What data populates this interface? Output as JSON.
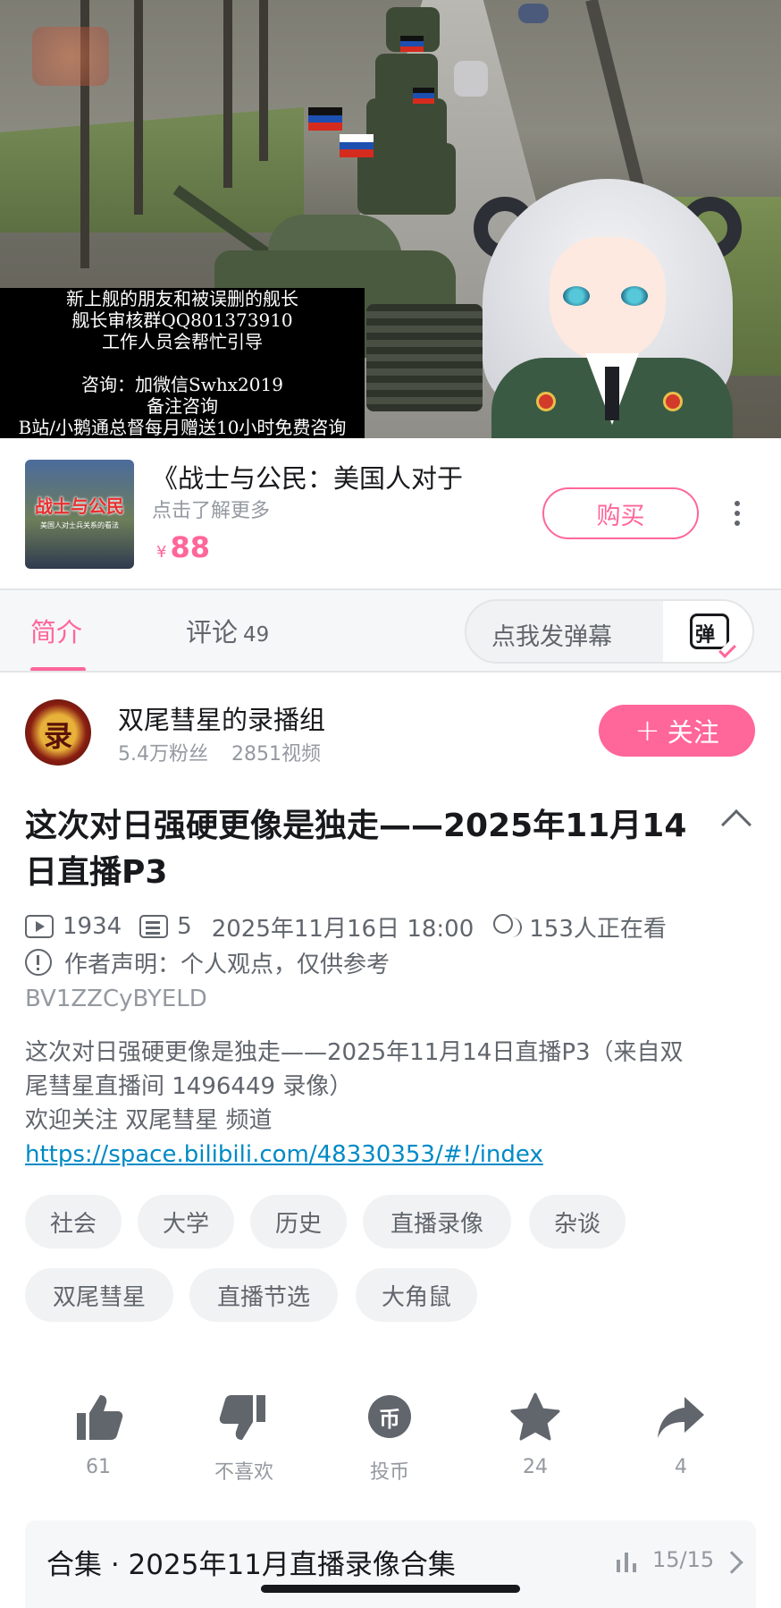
{
  "video": {
    "overlay_lines": [
      "新上舰的朋友和被误删的舰长",
      "舰长审核群QQ801373910",
      "工作人员会帮忙引导",
      "",
      "咨询：加微信Swhx2019",
      "备注咨询",
      "B站/小鹅通总督每月赠送10小时免费咨询"
    ]
  },
  "ad": {
    "thumb_title": "战士与公民",
    "thumb_subtitle": "美国人对士兵关系的看法",
    "title": "《战士与公民：美国人对于",
    "subtitle": "点击了解更多",
    "price_symbol": "¥",
    "price": "88",
    "buy_label": "购买"
  },
  "tabs": {
    "intro": "简介",
    "comments": "评论",
    "comments_count": "49",
    "danmaku_placeholder": "点我发弹幕",
    "danmaku_icon_char": "弹"
  },
  "uploader": {
    "avatar_char": "录",
    "name": "双尾彗星的录播组",
    "fans": "5.4万粉丝",
    "videos": "2851视频",
    "follow_plus": "+",
    "follow_label": "关注"
  },
  "video_info": {
    "title": "这次对日强硬更像是独走——2025年11月14日直播P3",
    "plays": "1934",
    "danmaku": "5",
    "date": "2025年11月16日 18:00",
    "watching": "153人正在看",
    "declaration": "作者声明：个人观点，仅供参考",
    "bvid": "BV1ZZCyBYELD",
    "description_lines": [
      "这次对日强硬更像是独走——2025年11月14日直播P3（来自双",
      "尾彗星直播间 1496449 录像）",
      "欢迎关注 双尾彗星 频道"
    ],
    "link": "https://space.bilibili.com/48330353/#!/index"
  },
  "tags": [
    "社会",
    "大学",
    "历史",
    "直播录像",
    "杂谈",
    "双尾彗星",
    "直播节选",
    "大角鼠"
  ],
  "actions": {
    "like_count": "61",
    "dislike_label": "不喜欢",
    "coin_label": "投币",
    "coin_char": "币",
    "favorite_count": "24",
    "share_count": "4"
  },
  "collection": {
    "title": "合集 · 2025年11月直播录像合集",
    "progress": "15/15"
  },
  "colors": {
    "accent": "#ff6699",
    "link": "#008ac5",
    "text_primary": "#18191c",
    "text_secondary": "#61666d",
    "text_tertiary": "#9499a0"
  }
}
